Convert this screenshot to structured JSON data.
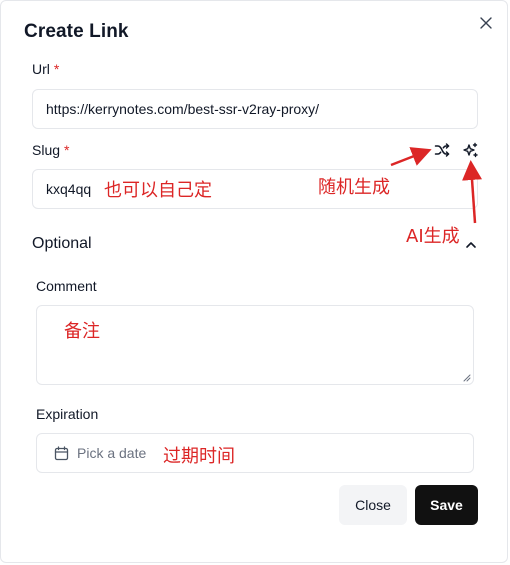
{
  "dialog": {
    "title": "Create Link",
    "close_icon": "close-icon"
  },
  "url_field": {
    "label": "Url",
    "required_mark": "*",
    "value": "https://kerrynotes.com/best-ssr-v2ray-proxy/"
  },
  "slug_field": {
    "label": "Slug",
    "required_mark": "*",
    "value": "kxq4qq",
    "random_icon": "shuffle-icon",
    "ai_icon": "sparkles-icon"
  },
  "optional_section": {
    "title": "Optional",
    "toggle_icon": "chevron-up-icon"
  },
  "comment_field": {
    "label": "Comment",
    "value": ""
  },
  "expiration_field": {
    "label": "Expiration",
    "placeholder": "Pick a date",
    "icon": "calendar-icon"
  },
  "actions": {
    "close_label": "Close",
    "save_label": "Save"
  },
  "annotations": {
    "slug_custom": "也可以自己定",
    "random_generate": "随机生成",
    "ai_generate": "AI生成",
    "comment_note": "备注",
    "expiration_note": "过期时间"
  },
  "colors": {
    "annotation_red": "#dc2626",
    "primary_button": "#111111",
    "secondary_button": "#f3f4f6",
    "border": "#e5e7eb"
  }
}
